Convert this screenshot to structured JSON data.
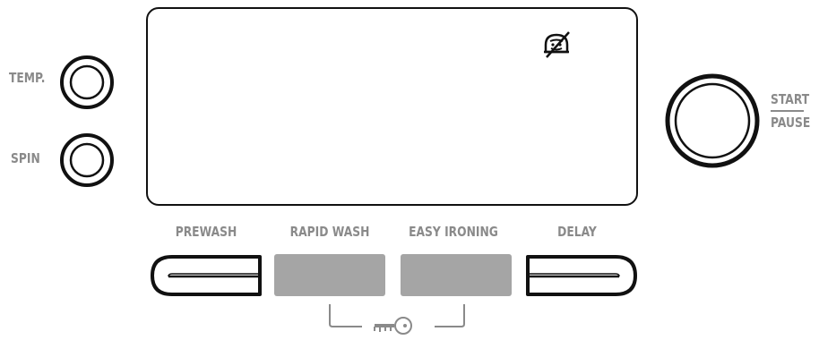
{
  "controls": {
    "temp_label": "TEMP.",
    "spin_label": "SPIN",
    "start_label": "START",
    "pause_label": "PAUSE"
  },
  "buttons": [
    {
      "label": "PREWASH",
      "style": "pill-left"
    },
    {
      "label": "RAPID WASH",
      "style": "gray"
    },
    {
      "label": "EASY IRONING",
      "style": "gray"
    },
    {
      "label": "DELAY",
      "style": "pill-right"
    }
  ],
  "display": {
    "icon": "no-ironing-icon"
  },
  "lock": {
    "icon": "key-icon"
  },
  "colors": {
    "label": "#8a8a8a",
    "gray_button": "#a5a5a5",
    "outline": "#111111"
  }
}
